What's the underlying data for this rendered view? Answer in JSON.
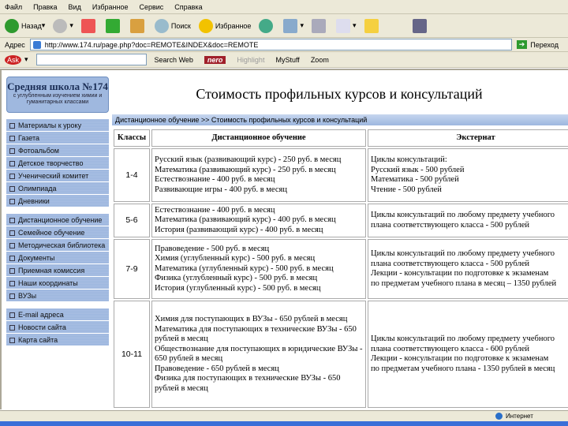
{
  "browser": {
    "menu": [
      "Файл",
      "Правка",
      "Вид",
      "Избранное",
      "Сервис",
      "Справка"
    ],
    "toolbar": {
      "back": "Назад",
      "search": "Поиск",
      "favorites": "Избранное"
    },
    "address_label": "Адрес",
    "address": "http://www.174.ru/page.php?doc=REMOTE&INDEX&doc=REMOTE",
    "go": "Переход",
    "ask": {
      "search_web": "Search Web",
      "nero": "nero",
      "highlight": "Highlight",
      "mystuff": "MyStuff",
      "zoom": "Zoom"
    },
    "status": "Интернет"
  },
  "sidebar": {
    "title": "Средняя школа №174",
    "subtitle": "с углубленным изучением химии и гуманитарных классами",
    "groups": [
      [
        "Материалы к уроку",
        "Газета",
        "Фотоальбом",
        "Детское творчество",
        "Ученический комитет",
        "Олимпиада",
        "Дневники"
      ],
      [
        "Дистанционное обучение",
        "Семейное обучение",
        "Методическая библиотека",
        "Документы",
        "Приемная комиссия",
        "Наши координаты",
        "ВУЗы"
      ],
      [
        "E-mail адреса",
        "Новости сайта",
        "Карта сайта"
      ]
    ]
  },
  "main": {
    "title": "Стоимость профильных курсов и консультаций",
    "breadcrumb": "Дистанционное обучение >> Стоимость профильных курсов и консультаций",
    "headers": [
      "Классы",
      "Дистанционное обучение",
      "Экстернат"
    ],
    "rows": [
      {
        "grade": "1-4",
        "distance": [
          "Русский язык (развивающий курс) - 250 руб. в месяц",
          "Математика (развивающий курс) - 250 руб. в месяц",
          "Естествознание - 400 руб. в месяц",
          "Развивающие игры - 400 руб. в месяц"
        ],
        "external": [
          "Циклы консультаций:",
          "Русский язык - 500 рублей",
          "Математика - 500 рублей",
          "Чтение - 500 рублей"
        ]
      },
      {
        "grade": "5-6",
        "distance": [
          "Естествознание - 400 руб. в месяц",
          "Математика (развивающий курс) - 400 руб. в месяц",
          "История (развивающий курс) - 400 руб. в месяц"
        ],
        "external": [
          "Циклы консультаций по любому предмету учебного",
          "плана соответствующего класса - 500 рублей"
        ]
      },
      {
        "grade": "7-9",
        "distance": [
          "Правоведение - 500 руб. в месяц",
          "Химия (углубленный курс) - 500 руб. в месяц",
          "Математика (углубленный курс) - 500 руб. в месяц",
          "Физика (углубленный курс) - 500 руб. в месяц",
          "История (углубленный курс) - 500 руб. в месяц"
        ],
        "external": [
          "Циклы консультаций по любому предмету учебного",
          "плана соответствующего класса - 500 рублей",
          "Лекции - консультации по подготовке к экзаменам",
          "по предметам учебного плана в месяц – 1350 рублей"
        ]
      },
      {
        "grade": "10-11",
        "distance": [
          "Химия для поступающих в ВУЗы - 650 рублей в месяц",
          "Математика для поступающих в технические ВУЗы - 650 рублей в месяц",
          "Обществознание для поступающих в юридические ВУЗы - 650 рублей в месяц",
          "Правоведение - 650 рублей в месяц",
          "Физика для поступающих в технические ВУЗы - 650 рублей в месяц"
        ],
        "external": [
          "Циклы консультаций по любому предмету учебного",
          "плана соответствующего класса - 600 рублей",
          "Лекции - консультации по подготовке к экзаменам",
          "по предметам учебного плана - 1350 рублей в месяц"
        ]
      }
    ]
  }
}
